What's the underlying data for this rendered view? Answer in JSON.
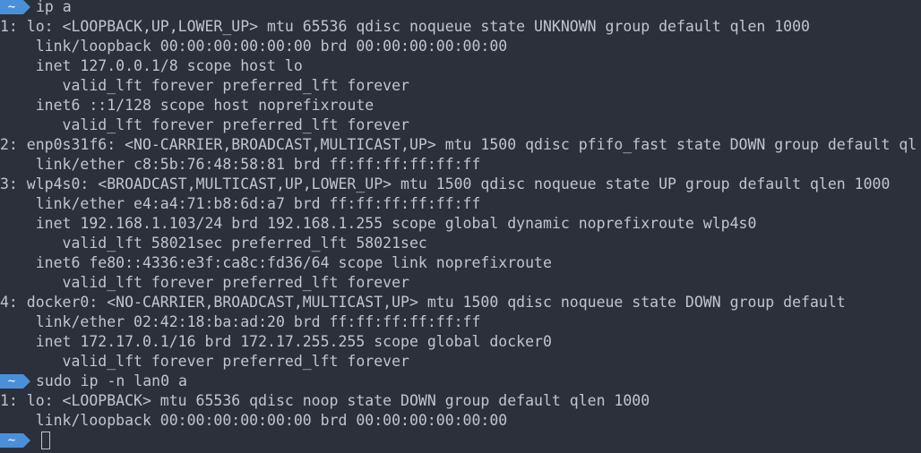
{
  "prompts": [
    {
      "dir": "~",
      "command": "ip a"
    },
    {
      "dir": "~",
      "command": "sudo ip -n lan0 a"
    },
    {
      "dir": "~",
      "command": ""
    }
  ],
  "output1": [
    "1: lo: <LOOPBACK,UP,LOWER_UP> mtu 65536 qdisc noqueue state UNKNOWN group default qlen 1000",
    "    link/loopback 00:00:00:00:00:00 brd 00:00:00:00:00:00",
    "    inet 127.0.0.1/8 scope host lo",
    "       valid_lft forever preferred_lft forever",
    "    inet6 ::1/128 scope host noprefixroute",
    "       valid_lft forever preferred_lft forever",
    "2: enp0s31f6: <NO-CARRIER,BROADCAST,MULTICAST,UP> mtu 1500 qdisc pfifo_fast state DOWN group default ql",
    "    link/ether c8:5b:76:48:58:81 brd ff:ff:ff:ff:ff:ff",
    "3: wlp4s0: <BROADCAST,MULTICAST,UP,LOWER_UP> mtu 1500 qdisc noqueue state UP group default qlen 1000",
    "    link/ether e4:a4:71:b8:6d:a7 brd ff:ff:ff:ff:ff:ff",
    "    inet 192.168.1.103/24 brd 192.168.1.255 scope global dynamic noprefixroute wlp4s0",
    "       valid_lft 58021sec preferred_lft 58021sec",
    "    inet6 fe80::4336:e3f:ca8c:fd36/64 scope link noprefixroute",
    "       valid_lft forever preferred_lft forever",
    "4: docker0: <NO-CARRIER,BROADCAST,MULTICAST,UP> mtu 1500 qdisc noqueue state DOWN group default",
    "    link/ether 02:42:18:ba:ad:20 brd ff:ff:ff:ff:ff:ff",
    "    inet 172.17.0.1/16 brd 172.17.255.255 scope global docker0",
    "       valid_lft forever preferred_lft forever"
  ],
  "output2": [
    "1: lo: <LOOPBACK> mtu 65536 qdisc noop state DOWN group default qlen 1000",
    "    link/loopback 00:00:00:00:00:00 brd 00:00:00:00:00:00"
  ],
  "colors": {
    "background": "#2b303b",
    "text": "#c0c5ce",
    "prompt_segment": "#4a90d9"
  }
}
